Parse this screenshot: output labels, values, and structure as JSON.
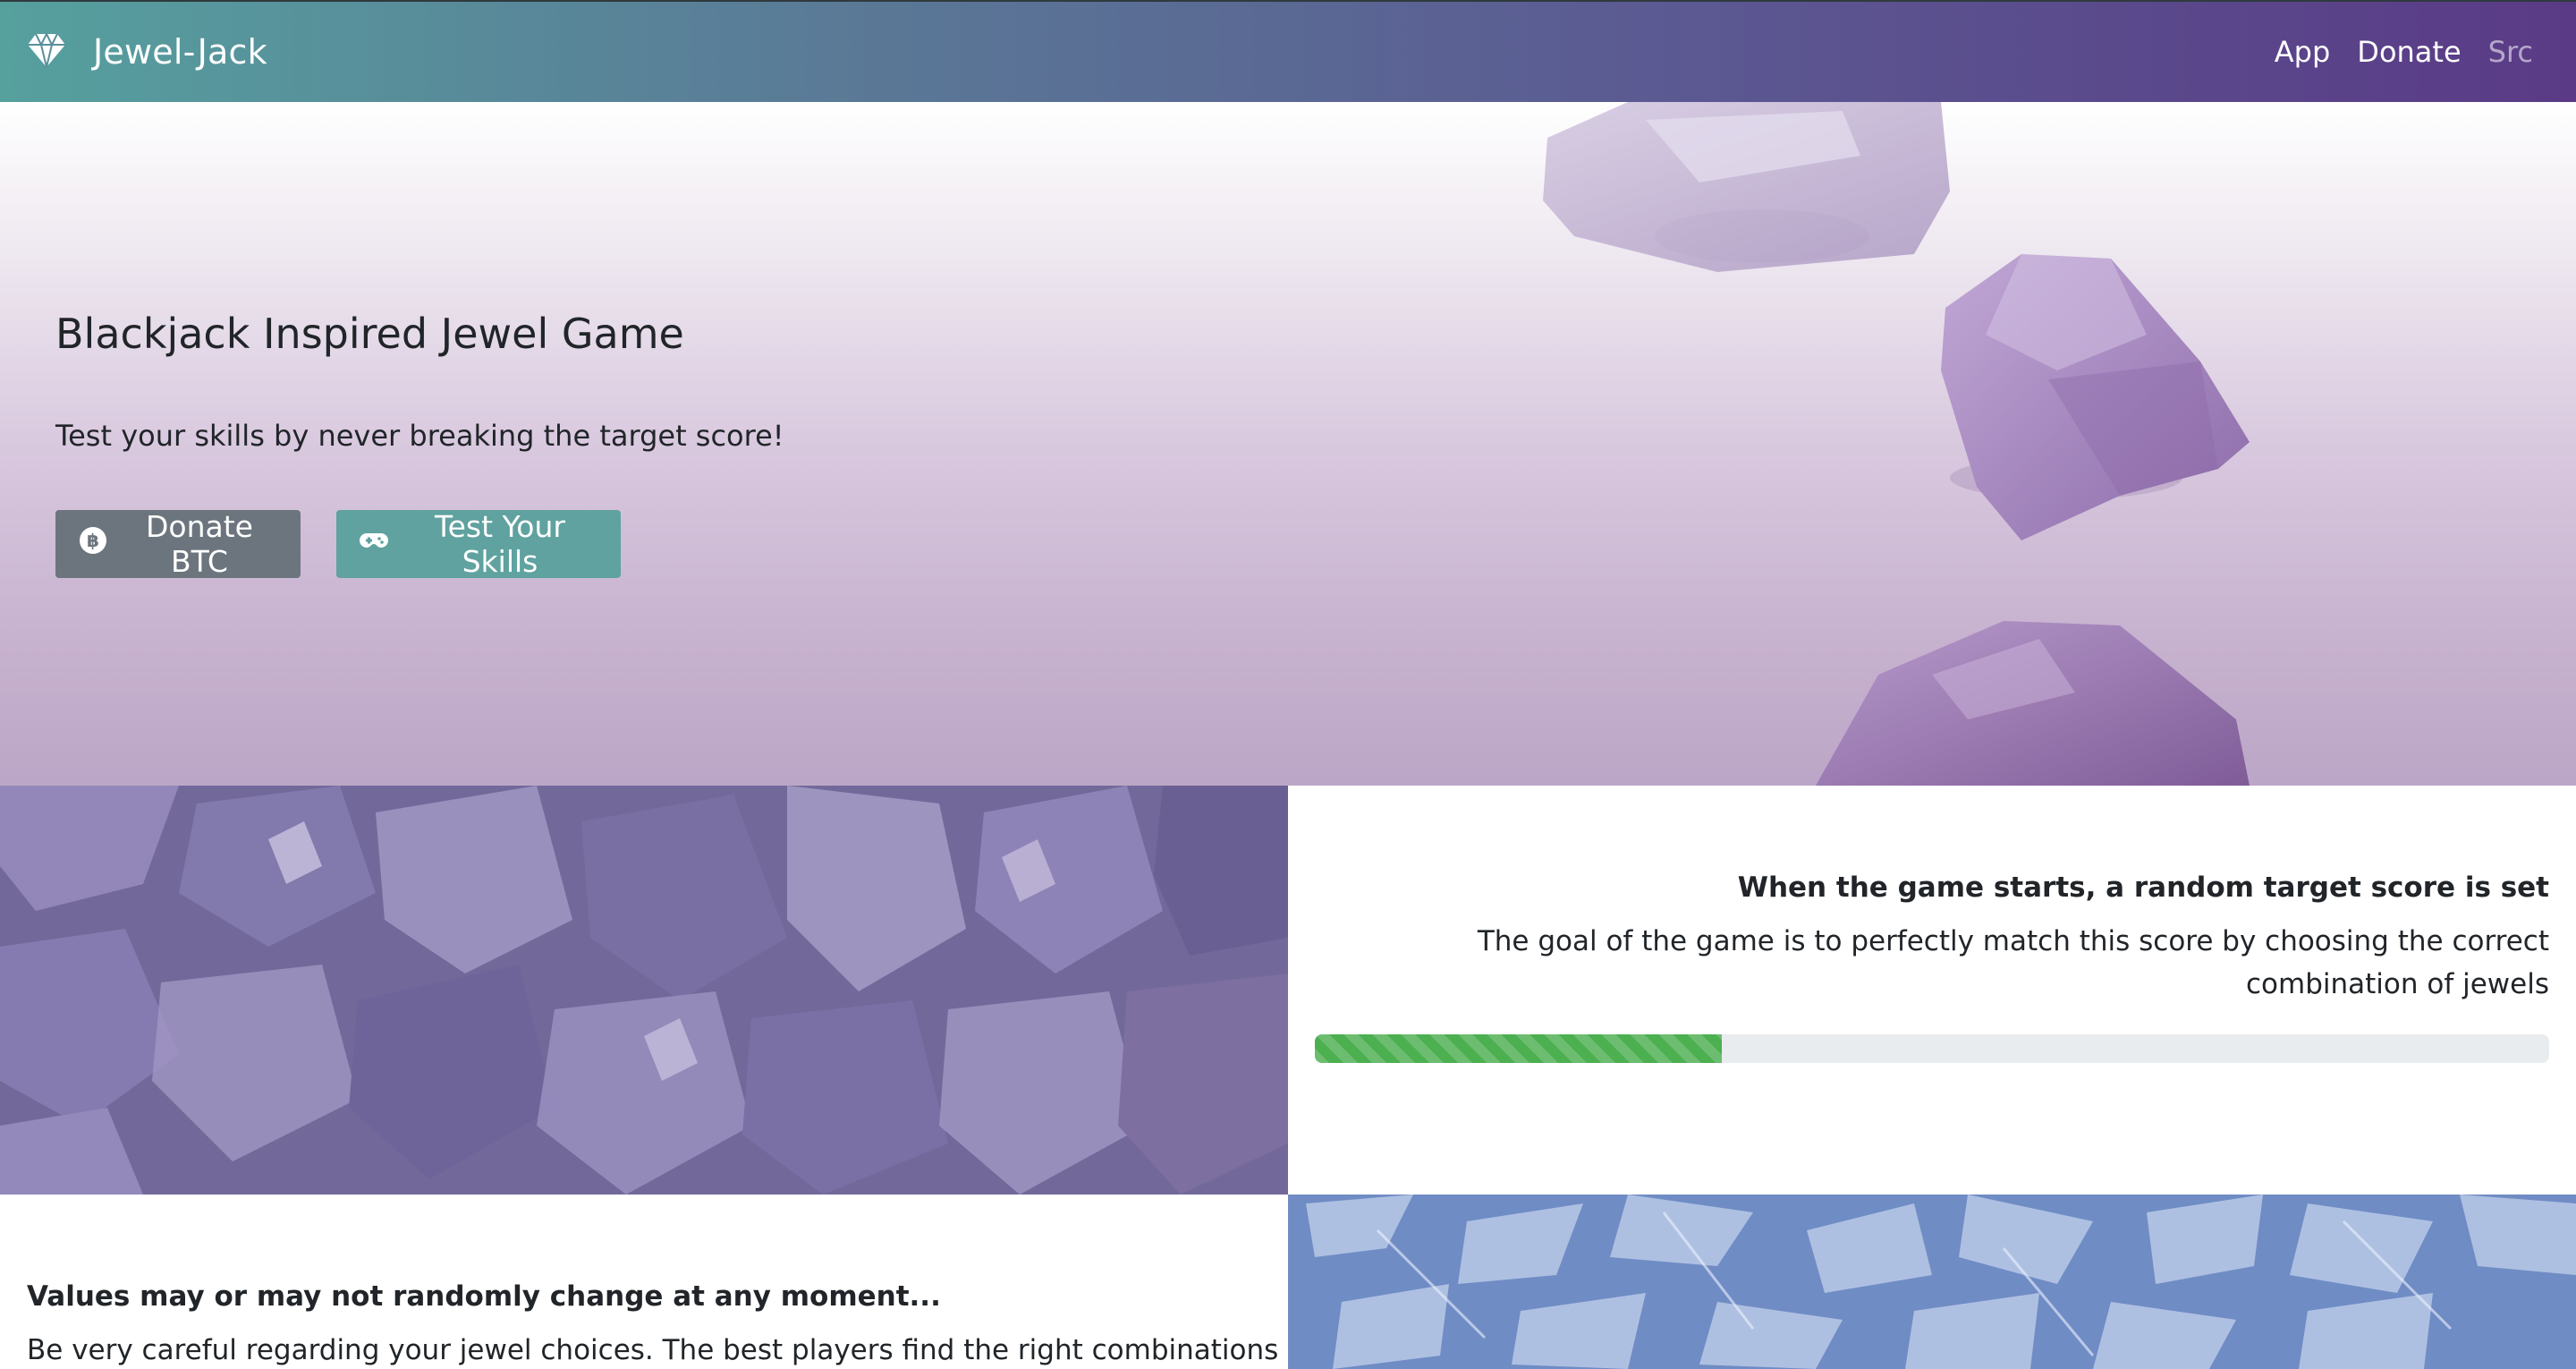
{
  "navbar": {
    "brand": "Jewel-Jack",
    "brand_icon": "gem-icon",
    "links": [
      {
        "label": "App",
        "muted": false
      },
      {
        "label": "Donate",
        "muted": false
      },
      {
        "label": "Src",
        "muted": true
      }
    ],
    "gradient": [
      "#56a09e",
      "#5a3a86"
    ]
  },
  "hero": {
    "title": "Blackjack Inspired Jewel Game",
    "subtitle": "Test your skills by never breaking the target score!",
    "buttons": [
      {
        "label": "Donate BTC",
        "icon": "bitcoin-icon",
        "color": "#6c757d"
      },
      {
        "label": "Test Your Skills",
        "icon": "gamepad-icon",
        "color": "#5fa29f"
      }
    ]
  },
  "feature1": {
    "title": "When the game starts, a random target score is set",
    "text": "The goal of the game is to perfectly match this score by choosing the correct combination of jewels",
    "progress_fraction": 0.33,
    "progress_color": "#4caf50"
  },
  "feature2": {
    "title": "Values may or may not randomly change at any moment...",
    "text": "Be very careful regarding your jewel choices. The best players find the right combinations to"
  }
}
